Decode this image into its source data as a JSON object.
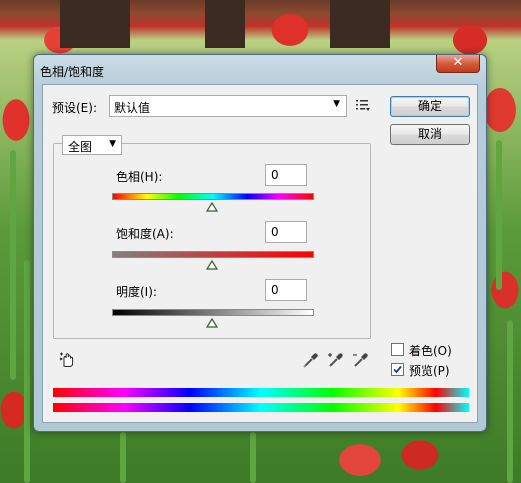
{
  "dialog": {
    "title": "色相/饱和度",
    "close_glyph": "✕"
  },
  "preset": {
    "label": "预设(E):",
    "value": "默认值",
    "menu_icon": "list-menu-icon"
  },
  "buttons": {
    "ok": "确定",
    "cancel": "取消"
  },
  "channel": {
    "value": "全图"
  },
  "sliders": {
    "hue": {
      "label": "色相(H):",
      "value": "0"
    },
    "saturation": {
      "label": "饱和度(A):",
      "value": "0"
    },
    "lightness": {
      "label": "明度(I):",
      "value": "0"
    }
  },
  "options": {
    "colorize": {
      "label": "着色(O)",
      "checked": false
    },
    "preview": {
      "label": "预览(P)",
      "checked": true
    }
  },
  "tools": [
    "hand-target-icon",
    "eyedropper-icon",
    "eyedropper-plus-icon",
    "eyedropper-minus-icon"
  ]
}
